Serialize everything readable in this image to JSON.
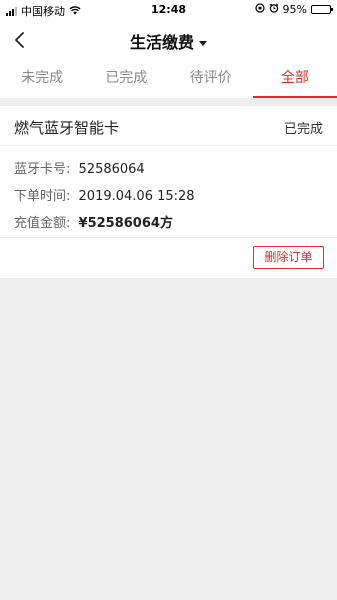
{
  "status_bar": {
    "carrier": "中国移动",
    "time": "12:48",
    "battery": "95%",
    "battery_level": 0.95
  },
  "nav": {
    "title": "生活缴费"
  },
  "tabs": [
    {
      "label": "未完成",
      "active": false
    },
    {
      "label": "已完成",
      "active": false
    },
    {
      "label": "待评价",
      "active": false
    },
    {
      "label": "全部",
      "active": true
    }
  ],
  "order": {
    "title": "燃气蓝牙智能卡",
    "status": "已完成",
    "card_no_label": "蓝牙卡号:",
    "card_no": "52586064",
    "time_label": "下单时间:",
    "time": "2019.04.06 15:28",
    "amount_label": "充值金额:",
    "amount": "¥52586064方",
    "delete_label": "删除订单"
  },
  "colors": {
    "accent": "#e0302b",
    "background": "#ededed"
  }
}
